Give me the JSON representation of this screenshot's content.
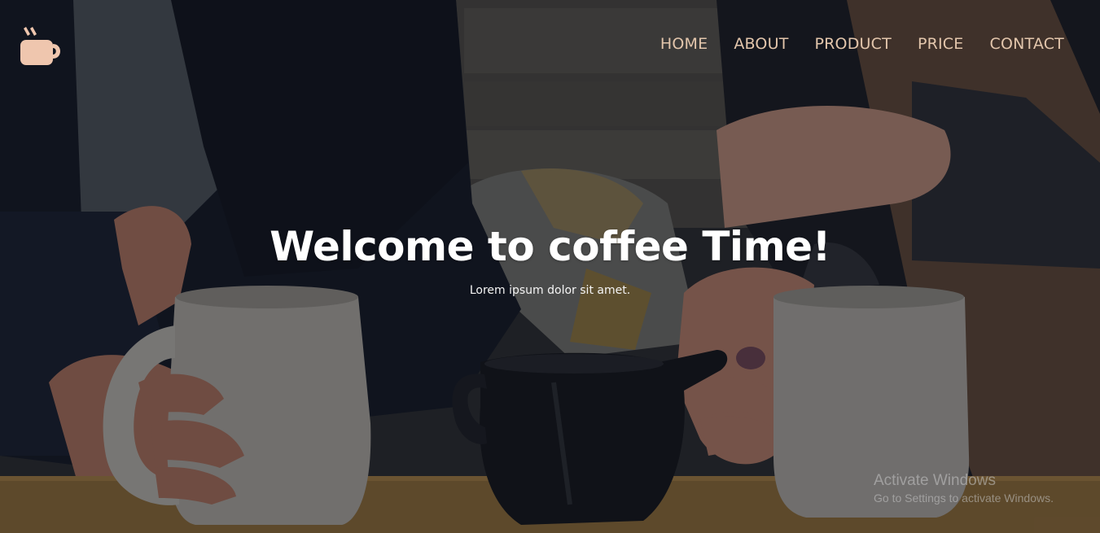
{
  "nav": {
    "items": [
      {
        "label": "HOME"
      },
      {
        "label": "ABOUT"
      },
      {
        "label": "PRODUCT"
      },
      {
        "label": "PRICE"
      },
      {
        "label": "CONTACT"
      }
    ]
  },
  "hero": {
    "title": "Welcome to coffee Time!",
    "subtitle": "Lorem ipsum dolor sit amet."
  },
  "watermark": {
    "title": "Activate Windows",
    "subtitle": "Go to Settings to activate Windows."
  },
  "icons": {
    "logo": "coffee-cup-icon"
  },
  "colors": {
    "nav_text": "#e3c6ac",
    "logo": "#efc6ae",
    "headline": "#ffffff"
  }
}
